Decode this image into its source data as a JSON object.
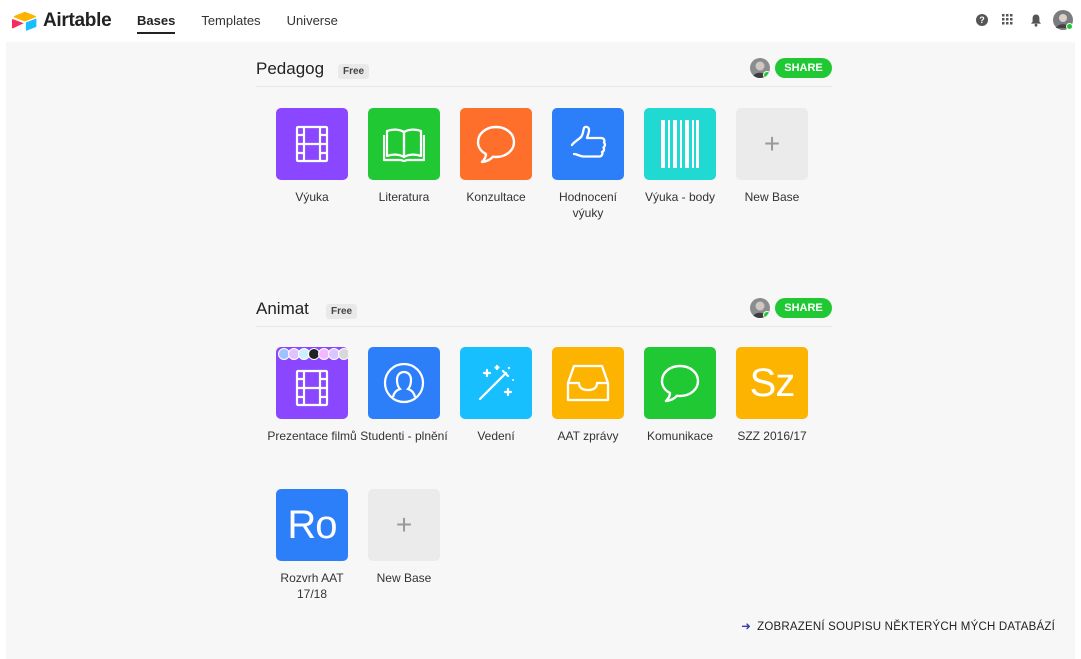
{
  "header": {
    "logo_text": "Airtable",
    "nav": [
      {
        "label": "Bases",
        "active": true
      },
      {
        "label": "Templates",
        "active": false
      },
      {
        "label": "Universe",
        "active": false
      }
    ],
    "icons": [
      "help-icon",
      "apps-grid-icon",
      "bell-icon",
      "user-avatar"
    ]
  },
  "workspaces": [
    {
      "name": "Pedagog",
      "badge": "Free",
      "share_label": "SHARE",
      "bases": [
        {
          "label": "Výuka",
          "color": "#8b46ff",
          "icon": "film-icon"
        },
        {
          "label": "Literatura",
          "color": "#20c933",
          "icon": "book-icon"
        },
        {
          "label": "Konzultace",
          "color": "#ff6f2c",
          "icon": "chat-bubble-icon"
        },
        {
          "label": "Hodnocení výuky",
          "color": "#2d7ff9",
          "icon": "thumbs-up-icon"
        },
        {
          "label": "Výuka - body",
          "color": "#20d9d2",
          "icon": "barcode-icon"
        },
        {
          "label": "New Base",
          "color": "#ebebeb",
          "icon": "plus-icon"
        }
      ]
    },
    {
      "name": "Animat",
      "badge": "Free",
      "share_label": "SHARE",
      "bases": [
        {
          "label": "Prezentace filmů",
          "color": "#8b46ff",
          "icon": "film-icon"
        },
        {
          "label": "Studenti - plnění",
          "color": "#2d7ff9",
          "icon": "user-silhouette-icon"
        },
        {
          "label": "Vedení",
          "color": "#18bfff",
          "icon": "magic-wand-icon"
        },
        {
          "label": "AAT zprávy",
          "color": "#fcb400",
          "icon": "inbox-tray-icon"
        },
        {
          "label": "Komunikace",
          "color": "#20c933",
          "icon": "chat-bubble-icon"
        },
        {
          "label": "SZZ 2016/17",
          "color": "#fcb400",
          "initials": "Sz"
        },
        {
          "label": "Rozvrh AAT 17/18",
          "color": "#2d7ff9",
          "initials": "Ro"
        },
        {
          "label": "New Base",
          "color": "#ebebeb",
          "icon": "plus-icon"
        }
      ]
    }
  ],
  "footer_link": "ZOBRAZENÍ SOUPISU NĚKTERÝCH MÝCH DATABÁZÍ"
}
